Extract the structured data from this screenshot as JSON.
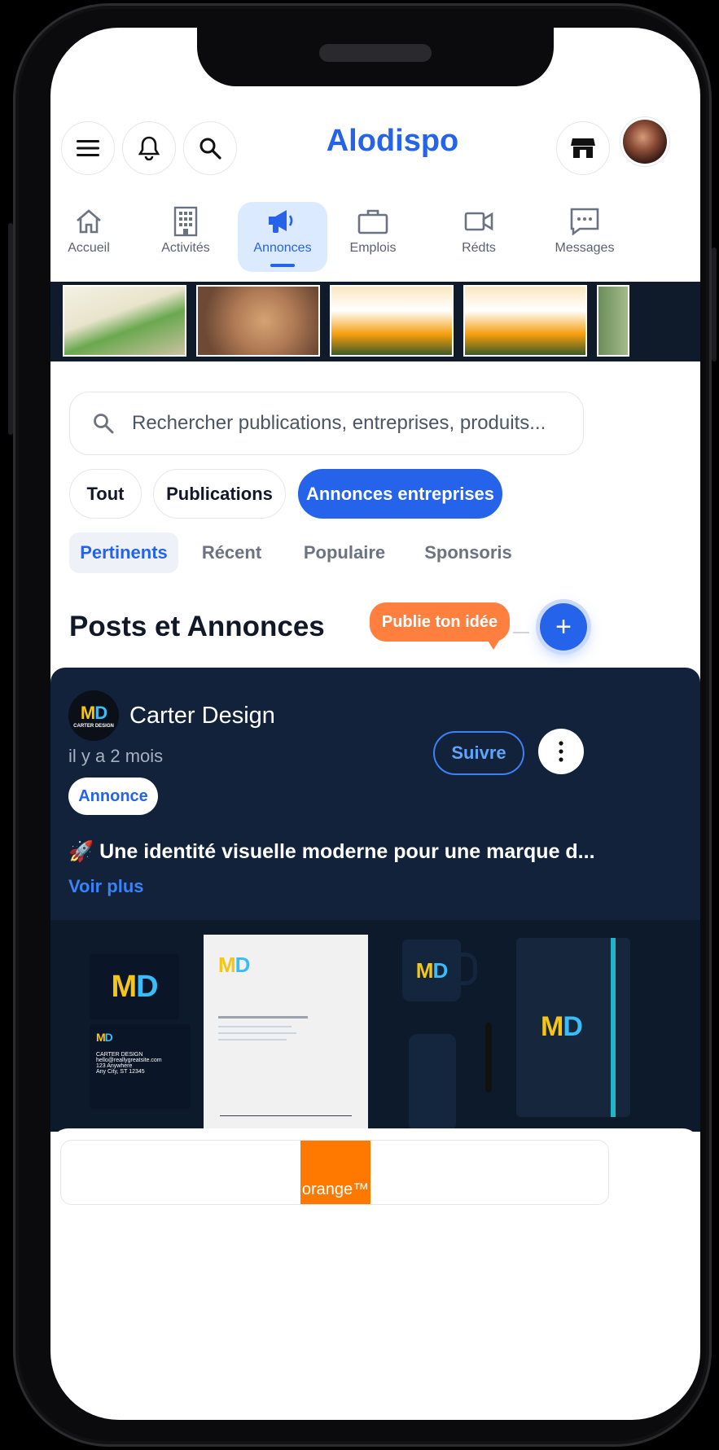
{
  "app": {
    "title": "Alodispo"
  },
  "header": {
    "icons": [
      "menu-icon",
      "bell-icon",
      "search-icon",
      "shop-icon"
    ]
  },
  "nav": {
    "items": [
      {
        "label": "Accueil",
        "icon": "home-icon",
        "active": false
      },
      {
        "label": "Activités",
        "icon": "building-icon",
        "active": false
      },
      {
        "label": "Annonces",
        "icon": "megaphone-icon",
        "active": true
      },
      {
        "label": "Emplois",
        "icon": "briefcase-icon",
        "active": false
      },
      {
        "label": "Rédts",
        "icon": "video-icon",
        "active": false
      },
      {
        "label": "Messages",
        "icon": "chat-icon",
        "active": false
      }
    ]
  },
  "search": {
    "placeholder": "Rechercher publications, entreprises, produits..."
  },
  "filters": [
    "Tout",
    "Publications",
    "Annonces entreprises"
  ],
  "sort_tabs": [
    "Pertinents",
    "Récent",
    "Populaire",
    "Sponsoris"
  ],
  "section": {
    "title": "Posts et Annonces",
    "publish_label": "Publie ton idée",
    "fab_label": "+"
  },
  "post": {
    "logo_text": "MD",
    "logo_sub": "CARTER DESIGN",
    "author": "Carter Design",
    "time": "il y a 2 mois",
    "tag": "Annonce",
    "follow_label": "Suivre",
    "text": "🚀 Une identité visuelle moderne pour une marque d...",
    "more_label": "Voir plus",
    "mockup": {
      "card_line1": "CARTER DESIGN",
      "card_line2": "hello@reallygreatsite.com",
      "card_line3": "123 Anywhere",
      "card_line4": "Any City, ST 12345"
    }
  },
  "ad": {
    "brand": "orange™"
  },
  "colors": {
    "accent": "#2563eb",
    "orange": "#ff7f3f",
    "card_bg": "#12223a"
  }
}
